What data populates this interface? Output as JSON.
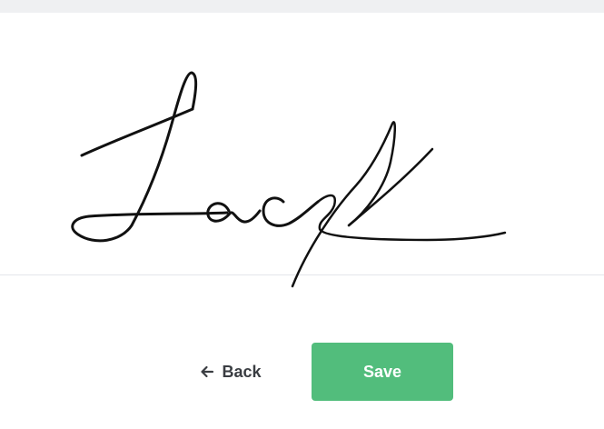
{
  "actions": {
    "back_label": "Back",
    "save_label": "Save"
  },
  "icons": {
    "back": "arrow-left-icon"
  },
  "colors": {
    "save_button": "#52bd7c",
    "ink": "#111111",
    "top_strip": "#eff0f2"
  }
}
